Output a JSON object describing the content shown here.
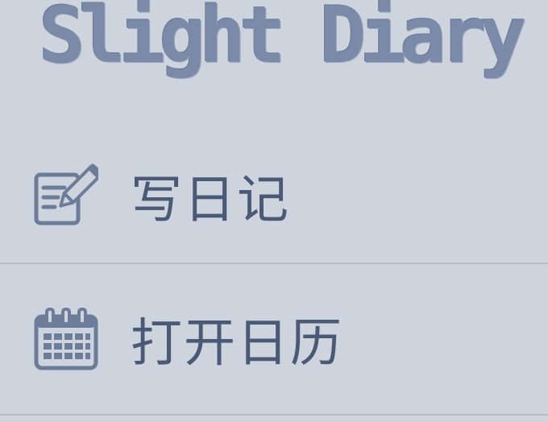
{
  "app": {
    "title": "Slight Diary"
  },
  "menu": {
    "items": [
      {
        "label": "写日记",
        "icon": "edit-note-icon"
      },
      {
        "label": "打开日历",
        "icon": "calendar-icon"
      }
    ]
  },
  "colors": {
    "background": "#ced4de",
    "title": "#7a8aa8",
    "label": "#4a5a76",
    "icon": "#6d7c98",
    "divider": "#b4bcc8"
  }
}
